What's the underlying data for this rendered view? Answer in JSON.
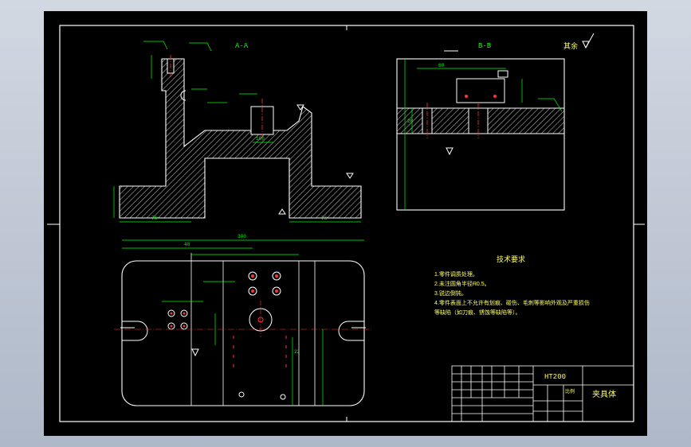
{
  "drawing": {
    "section_aa_label": "A-A",
    "section_bb_label": "B-B",
    "roughness_rest_label": "其余",
    "tech_req": {
      "title": "技术要求",
      "items": [
        "1.零件调质处理。",
        "2.未注圆角半径R0.5。",
        "3.锐边倒钝。",
        "4.零件表面上不允许有划痕、碰伤、毛刺等影响外观及严重损伤",
        "等缺陷（如刀痕、锈蚀等缺陷等）。"
      ]
    },
    "title_block": {
      "material": "HT200",
      "part_name": "夹具体",
      "scale_label": "比例"
    },
    "dims": {
      "top_overall": "300",
      "width_a": "40",
      "height_b": "22",
      "base_left": "76",
      "base_right": "76",
      "center": "100",
      "bb_width": "60",
      "bb_height": "28"
    }
  },
  "colors": {
    "background": "#000000",
    "outline": "#ffffff",
    "dimension": "#00ff00",
    "hole": "#ff3333",
    "centerline": "#ff3333",
    "frame": "#ffffff",
    "text_yellow": "#ffff66"
  }
}
